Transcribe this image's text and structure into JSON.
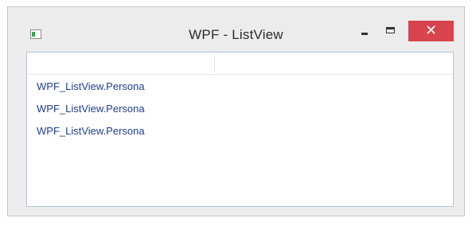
{
  "window": {
    "title": "WPF - ListView",
    "controls": {
      "minimize": "minimize",
      "maximize": "maximize",
      "close_label": "✕"
    }
  },
  "listview": {
    "header": {
      "columns": [
        {
          "label": ""
        },
        {
          "label": ""
        }
      ]
    },
    "items": [
      {
        "label": "WPF_ListView.Persona"
      },
      {
        "label": "WPF_ListView.Persona"
      },
      {
        "label": "WPF_ListView.Persona"
      }
    ]
  },
  "icons": {
    "app": "window-app-icon",
    "minimize": "minimize-icon",
    "maximize": "maximize-icon",
    "close": "close-icon"
  },
  "colors": {
    "close_button_bg": "#d9434d",
    "item_text": "#1f3f8a",
    "content_border": "#b5c6d6",
    "window_bg": "#ececec"
  }
}
